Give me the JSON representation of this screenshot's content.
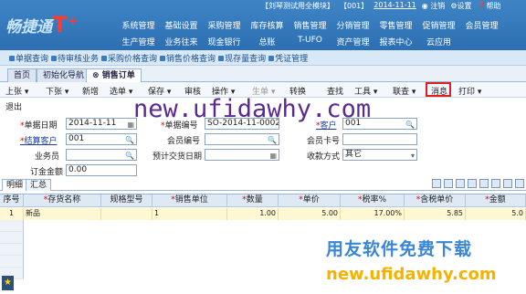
{
  "app": {
    "logo_text": "畅捷通",
    "logo_plus": "T⁺"
  },
  "info_bar": [
    "【刘琴测试用全模块】",
    "【001】",
    "2014-11-11",
    "注销",
    "设置",
    "帮助"
  ],
  "menu_row1": [
    "系统管理",
    "基础设置",
    "采购管理",
    "库存核算",
    "销售管理",
    "分销管理",
    "零售管理",
    "促销管理",
    "会员管理"
  ],
  "menu_row2": [
    "生产管理",
    "业务往来",
    "现金银行",
    "总账",
    "T-UFO",
    "资产管理",
    "报表中心",
    "云应用"
  ],
  "quick_links": [
    "单据查询",
    "待审核业务",
    "采购价格查询",
    "销售价格查询",
    "现存量查询",
    "凭证管理"
  ],
  "tabs": [
    "首页",
    "初始化导航",
    "销售订单"
  ],
  "toolbar": [
    "上张",
    "下张",
    "新增",
    "选单",
    "保存",
    "审核",
    "操作",
    "生单",
    "转换",
    "查找",
    "工具",
    "联查",
    "消息",
    "打印"
  ],
  "exit_label": "退出",
  "watermark": "new.ufidawhy.com",
  "form": {
    "doc_date_label": "单据日期",
    "doc_date": "2014-11-11",
    "doc_no_label": "单据编号",
    "doc_no": "SO-2014-11-0002",
    "customer_label": "客户",
    "customer": "001",
    "settle_customer_label": "结算客户",
    "settle_customer": "001",
    "member_no_label": "会员编号",
    "member_no": "",
    "member_card_label": "会员卡号",
    "member_card": "",
    "salesperson_label": "业务员",
    "salesperson": "",
    "delivery_date_label": "预计交货日期",
    "delivery_date": "",
    "payment_label": "收款方式",
    "payment": "其它",
    "deposit_label": "订金金额",
    "deposit": "0.00"
  },
  "sub_tabs": [
    "明细",
    "汇总"
  ],
  "grid": {
    "headers": [
      "序号",
      "存货名称",
      "规格型号",
      "销售单位",
      "数量",
      "单价",
      "税率%",
      "含税单价",
      "金额"
    ],
    "rows": [
      [
        "1",
        "新品",
        "",
        "1",
        "1.00",
        "5.00",
        "17.00%",
        "5.85",
        "5.0"
      ]
    ]
  },
  "ad_text": "用友软件免费下载",
  "ad_url": "new.ufidawhy.com"
}
